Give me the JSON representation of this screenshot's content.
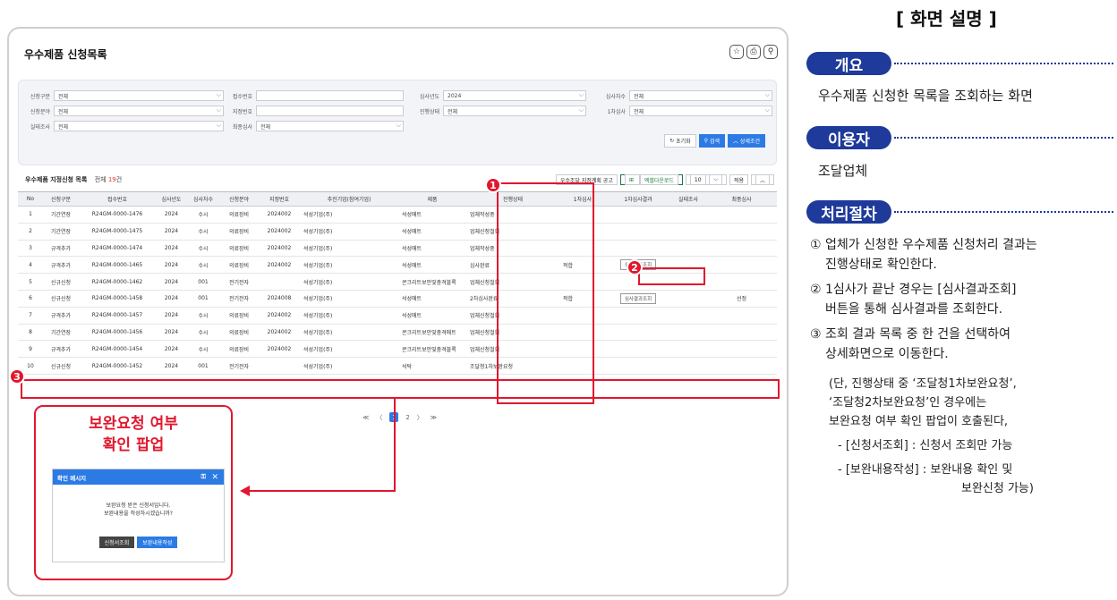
{
  "page_title": "우수제품 신청목록",
  "title_icons": [
    "star-icon",
    "print-icon",
    "search-icon"
  ],
  "filters": {
    "apply_type": {
      "label": "신청구분",
      "value": "전체"
    },
    "receipt_no": {
      "label": "접수번호",
      "value": ""
    },
    "review_year": {
      "label": "심사년도",
      "value": "2024"
    },
    "review_round": {
      "label": "심사차수",
      "value": "전체"
    },
    "apply_field": {
      "label": "신청분야",
      "value": "전체"
    },
    "designation_no": {
      "label": "지정번호",
      "value": ""
    },
    "progress": {
      "label": "진행상태",
      "value": "전체"
    },
    "first_review": {
      "label": "1차심사",
      "value": "전체"
    },
    "inspection": {
      "label": "실태조사",
      "value": "전체"
    },
    "final_review": {
      "label": "최종심사",
      "value": "전체"
    }
  },
  "search_buttons": {
    "reset": "초기화",
    "search": "검색",
    "detail": "상세조건"
  },
  "list": {
    "title": "우수제품 지정신청 목록",
    "count_prefix": "전체",
    "count_value": "19",
    "count_suffix": "건",
    "tool_plan": "우수조달 지정계획 공고",
    "tool_excel": "엑셀다운로드",
    "page_size": "10",
    "apply": "적용"
  },
  "columns": [
    "No",
    "신청구분",
    "접수번호",
    "심사년도",
    "심사차수",
    "신청분야",
    "지정번호",
    "추진기업(참여기업)",
    "제품",
    "진행상태",
    "1차심사",
    "1차심사결과",
    "실태조사",
    "최종심사"
  ],
  "rows": [
    {
      "no": "1",
      "type": "기간연장",
      "receipt": "R24GM-0000-1476",
      "year": "2024",
      "round": "수시",
      "field": "의료장비",
      "desig": "2024002",
      "company": "석성기업(주)",
      "product": "석성매트",
      "status": "업체작성중",
      "first": "",
      "result": "",
      "insp": "",
      "final": ""
    },
    {
      "no": "2",
      "type": "기간연장",
      "receipt": "R24GM-0000-1475",
      "year": "2024",
      "round": "수시",
      "field": "의료장비",
      "desig": "2024002",
      "company": "석성기업(주)",
      "product": "석성매트",
      "status": "업체신청철회",
      "first": "",
      "result": "",
      "insp": "",
      "final": ""
    },
    {
      "no": "3",
      "type": "규격추가",
      "receipt": "R24GM-0000-1474",
      "year": "2024",
      "round": "수시",
      "field": "의료장비",
      "desig": "2024002",
      "company": "석성기업(주)",
      "product": "석성매트",
      "status": "업체작성중",
      "first": "",
      "result": "",
      "insp": "",
      "final": ""
    },
    {
      "no": "4",
      "type": "규격추가",
      "receipt": "R24GM-0000-1465",
      "year": "2024",
      "round": "수시",
      "field": "의료장비",
      "desig": "2024002",
      "company": "석성기업(주)",
      "product": "석성매트",
      "status": "심사완료",
      "first": "적합",
      "result": "심사결과조회",
      "insp": "",
      "final": ""
    },
    {
      "no": "5",
      "type": "신규신청",
      "receipt": "R24GM-0000-1462",
      "year": "2024",
      "round": "001",
      "field": "전기전자",
      "desig": "",
      "company": "석성기업(주)",
      "product": "콘크리트보안및충격블록",
      "status": "업체신청철회",
      "first": "",
      "result": "",
      "insp": "",
      "final": ""
    },
    {
      "no": "6",
      "type": "신규신청",
      "receipt": "R24GM-0000-1458",
      "year": "2024",
      "round": "001",
      "field": "전기전자",
      "desig": "2024008",
      "company": "석성기업(주)",
      "product": "석성매트",
      "status": "2차심사완료",
      "first": "적합",
      "result": "심사결과조회",
      "insp": "",
      "final": "선정"
    },
    {
      "no": "7",
      "type": "규격추가",
      "receipt": "R24GM-0000-1457",
      "year": "2024",
      "round": "수시",
      "field": "의료장비",
      "desig": "2024002",
      "company": "석성기업(주)",
      "product": "석성매트",
      "status": "업체신청철회",
      "first": "",
      "result": "",
      "insp": "",
      "final": ""
    },
    {
      "no": "8",
      "type": "기간연장",
      "receipt": "R24GM-0000-1456",
      "year": "2024",
      "round": "수시",
      "field": "의료장비",
      "desig": "2024002",
      "company": "석성기업(주)",
      "product": "콘크리트보안및충격매트",
      "status": "업체신청철회",
      "first": "",
      "result": "",
      "insp": "",
      "final": ""
    },
    {
      "no": "9",
      "type": "규격추가",
      "receipt": "R24GM-0000-1454",
      "year": "2024",
      "round": "수시",
      "field": "의료장비",
      "desig": "2024002",
      "company": "석성기업(주)",
      "product": "콘크리트보안및충격블록",
      "status": "업체신청철회",
      "first": "",
      "result": "",
      "insp": "",
      "final": ""
    },
    {
      "no": "10",
      "type": "신규신청",
      "receipt": "R24GM-0000-1452",
      "year": "2024",
      "round": "001",
      "field": "전기전자",
      "desig": "",
      "company": "석성기업(주)",
      "product": "석탁",
      "status": "조달청1차보완요청",
      "first": "",
      "result": "",
      "insp": "",
      "final": ""
    }
  ],
  "pager": {
    "first": "≪",
    "prev": "〈",
    "current": "1",
    "next_page": "2",
    "next": "〉",
    "last": "≫"
  },
  "badges": [
    "1",
    "2",
    "3"
  ],
  "popup": {
    "heading_line1": "보완요청 여부",
    "heading_line2": "확인 팝업",
    "dialog_title": "확인 메시지",
    "message_line1": "보완요청 받은 신청서입니다.",
    "message_line2": "보완내용을 작성하시겠습니까?",
    "btn_view": "신청서조회",
    "btn_write": "보완내용작성"
  },
  "desc": {
    "title": "[ 화면 설명 ]",
    "overview_label": "개요",
    "overview_text": "우수제품 신청한 목록을 조회하는 화면",
    "user_label": "이용자",
    "user_text": "조달업체",
    "process_label": "처리절차",
    "step1a": "① 업체가 신청한 우수제품 신청처리 결과는",
    "step1b": "진행상태로 확인한다.",
    "step2a": "② 1심사가 끝난 경우는 [심사결과조회]",
    "step2b": "버튼을 통해 심사결과를 조회한다.",
    "step3a": "③ 조회 결과 목록 중 한 건을 선택하여",
    "step3b": "상세화면으로 이동한다.",
    "note1": "(단, 진행상태 중 ‘조달청1차보완요청’,",
    "note2": "‘조달청2차보완요청’인 경우에는",
    "note3": "보완요청 여부 확인 팝업이 호출된다,",
    "note4": "- [신청서조회] : 신청서 조회만 가능",
    "note5": "- [보완내용작성] : 보완내용 확인 및",
    "note6": "보완신청 가능)"
  }
}
